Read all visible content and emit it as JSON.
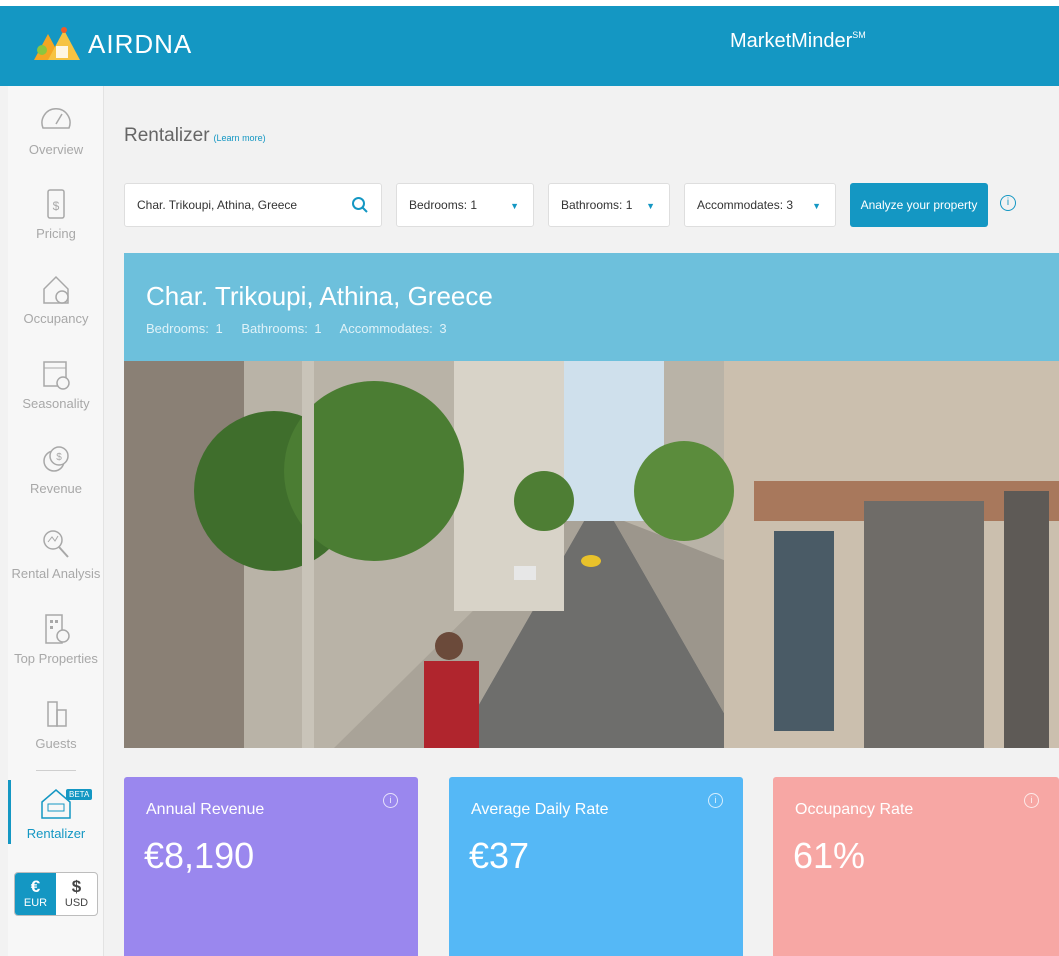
{
  "header": {
    "logo_text": "AIRDNA",
    "product": "MarketMinder",
    "product_mark": "SM",
    "bar_color": "#1497c3"
  },
  "sidebar": {
    "items": [
      {
        "label": "Overview",
        "icon": "speedometer-icon"
      },
      {
        "label": "Pricing",
        "icon": "price-tag-icon"
      },
      {
        "label": "Occupancy",
        "icon": "house-clock-icon"
      },
      {
        "label": "Seasonality",
        "icon": "calendar-icon"
      },
      {
        "label": "Revenue",
        "icon": "coins-icon"
      },
      {
        "label": "Rental Analysis",
        "icon": "magnifier-chart-icon"
      },
      {
        "label": "Top Properties",
        "icon": "building-icon"
      },
      {
        "label": "Guests",
        "icon": "guests-icon"
      },
      {
        "label": "Rentalizer",
        "icon": "rent-house-icon",
        "badge": "BETA",
        "active": true
      }
    ],
    "currency": {
      "eur_symbol": "€",
      "eur_label": "EUR",
      "usd_symbol": "$",
      "usd_label": "USD",
      "selected": "EUR"
    }
  },
  "main": {
    "title": "Rentalizer",
    "learn_more": "(Learn more)",
    "search": {
      "value": "Char. Trikoupi, Athina, Greece"
    },
    "bedrooms": "Bedrooms: 1",
    "bathrooms": "Bathrooms: 1",
    "accommodates": "Accommodates: 3",
    "analyze_button": "Analyze your property"
  },
  "hero": {
    "title": "Char. Trikoupi, Athina, Greece",
    "bedrooms": "Bedrooms: 1",
    "bathrooms": "Bathrooms: 1",
    "accommodates": "Accommodates: 3",
    "color": "#6dc0dc"
  },
  "cards": [
    {
      "label": "Annual Revenue",
      "value": "€8,190",
      "color": "#9a87ee"
    },
    {
      "label": "Average Daily Rate",
      "value": "€37",
      "color": "#55b8f6"
    },
    {
      "label": "Occupancy Rate",
      "value": "61%",
      "color": "#f7a7a4"
    }
  ]
}
